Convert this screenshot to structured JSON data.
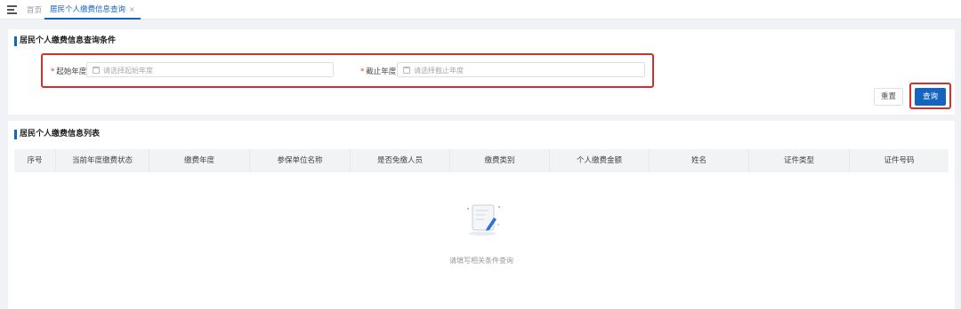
{
  "tabs": {
    "home": "首页",
    "active": "居民个人缴费信息查询",
    "close": "×"
  },
  "search": {
    "title": "居民个人缴费信息查询条件",
    "required_mark": "*",
    "start_label": "起始年度",
    "start_placeholder": "请选择起始年度",
    "end_label": "截止年度",
    "end_placeholder": "请选择截止年度",
    "reset": "重置",
    "query": "查询"
  },
  "list": {
    "title": "居民个人缴费信息列表",
    "columns": [
      "序号",
      "当前年度缴费状态",
      "缴费年度",
      "参保单位名称",
      "是否免缴人员",
      "缴费类别",
      "个人缴费金额",
      "姓名",
      "证件类型",
      "证件号码"
    ],
    "empty_text": "请填写相关条件查询"
  },
  "colors": {
    "primary": "#1565c0",
    "highlight": "#d32f2f",
    "required": "#e53935"
  }
}
